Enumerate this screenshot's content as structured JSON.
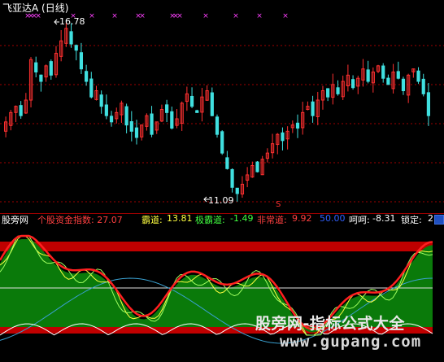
{
  "chart_title": "飞亚达A (日线)",
  "annotations": {
    "price_high": "16.78",
    "price_low": "11.09",
    "sell_marker": "S"
  },
  "indicator_bar": {
    "name": "股旁网",
    "fund_index_label": "个股资金指数: 27.07",
    "badao_label": "霸道:",
    "badao_value": "13.81",
    "jibadao_label": "极霸道:",
    "jibadao_value": "-1.49",
    "feichangdao_label": "非常道:",
    "feichangdao_value": "9.92",
    "level_value": "50.00",
    "hehe_label": "呵呵:",
    "hehe_value": "-8.31",
    "suoding_label": "锁定:",
    "suoding_value": "2"
  },
  "watermark": {
    "cn": "股旁网-指标公式大全",
    "url": "www.gupang.com"
  },
  "colors": {
    "up": "#ff3030",
    "down": "#40e0e0",
    "magenta_marker": "#ff40ff",
    "grid_red": "#a00000",
    "badao_yellow": "#ffff40",
    "jibadao_green": "#40ff40",
    "feichangdao_red": "#ff4040",
    "level_blue": "#3060ff",
    "fill_green": "#0a7a0a",
    "band_red": "#c00000",
    "line_white": "#ffffff",
    "line_blue": "#3aa0d0"
  },
  "chart_data": {
    "type": "candlestick",
    "price_high": 16.78,
    "price_low": 11.09,
    "ohlc_close": [
      13.6,
      13.9,
      14.1,
      13.8,
      14.3,
      15.6,
      15.2,
      14.9,
      15.4,
      15.1,
      15.8,
      16.2,
      16.6,
      16.1,
      15.9,
      15.3,
      14.9,
      14.4,
      14.6,
      14.1,
      13.8,
      13.6,
      13.9,
      14.2,
      13.5,
      13.3,
      13.1,
      13.5,
      13.8,
      13.2,
      13.6,
      14.0,
      13.9,
      13.4,
      13.7,
      14.2,
      14.5,
      14.1,
      13.9,
      14.4,
      14.6,
      13.8,
      13.2,
      12.6,
      12.1,
      11.5,
      11.3,
      11.6,
      11.9,
      12.2,
      12.0,
      12.4,
      12.6,
      12.9,
      13.2,
      13.0,
      13.3,
      13.5,
      13.4,
      13.9,
      14.1,
      13.8,
      14.3,
      14.6,
      14.4,
      14.8,
      14.5,
      14.9,
      15.1,
      14.7,
      15.0,
      15.3,
      14.9,
      15.2,
      15.4,
      15.0,
      14.8,
      15.2,
      15.0,
      14.6,
      15.1,
      15.3,
      14.9,
      14.5,
      13.8
    ]
  }
}
